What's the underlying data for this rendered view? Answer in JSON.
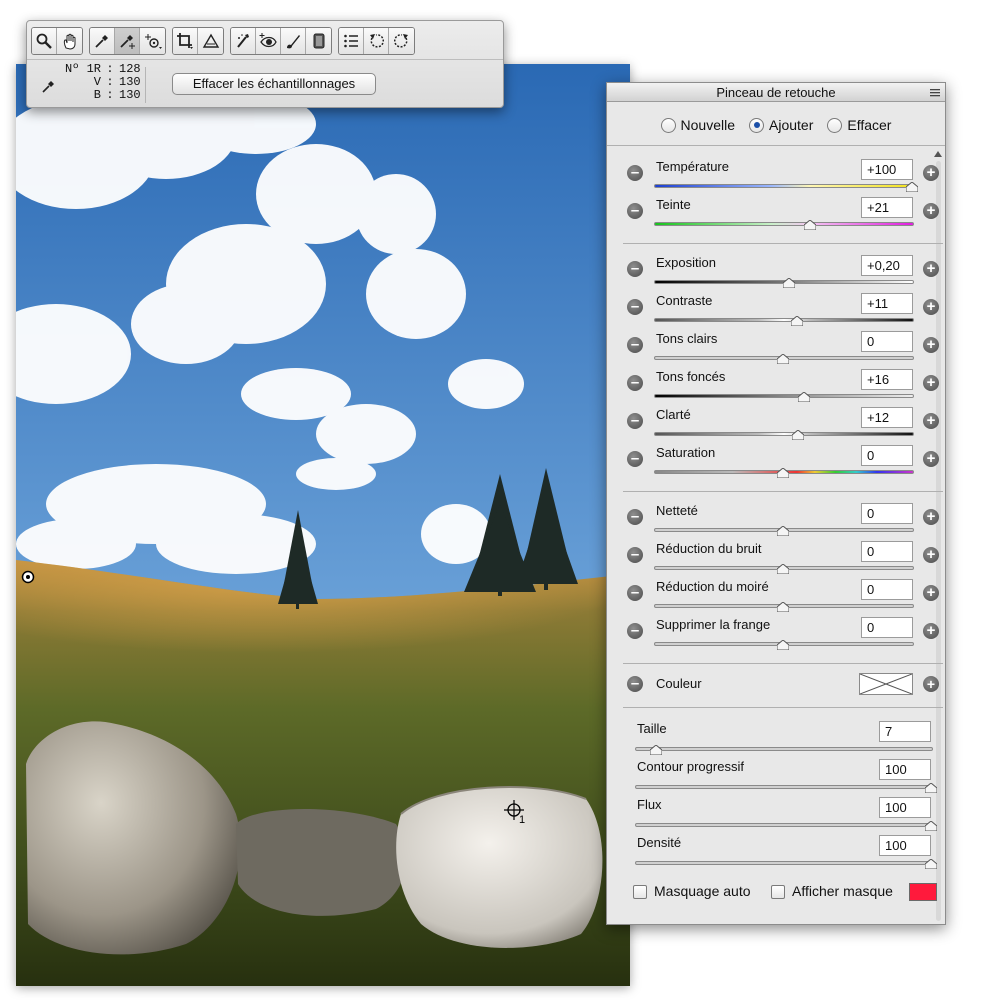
{
  "toolbar": {
    "tools": [
      [
        "zoom-tool-icon",
        "hand-tool-icon"
      ],
      [
        "white-balance-tool-icon",
        "color-sampler-tool-icon",
        "targeted-adjustment-tool-icon"
      ],
      [
        "crop-tool-icon",
        "straighten-tool-icon"
      ],
      [
        "spot-removal-tool-icon",
        "red-eye-tool-icon",
        "adjustment-brush-tool-icon",
        "graduated-filter-tool-icon"
      ],
      [
        "preferences-icon",
        "rotate-left-icon",
        "rotate-right-icon"
      ]
    ],
    "active_tool": "color-sampler-tool-icon",
    "readout": {
      "number_label": "Nº 1R",
      "r_value": "128",
      "v_label": "V",
      "v_value": "130",
      "b_label": "B",
      "b_value": "130"
    },
    "clear_samplers_label": "Effacer les échantillonnages"
  },
  "panel": {
    "title": "Pinceau de retouche",
    "modes": [
      {
        "label": "Nouvelle",
        "checked": false
      },
      {
        "label": "Ajouter",
        "checked": true
      },
      {
        "label": "Effacer",
        "checked": false
      }
    ],
    "sliders": [
      {
        "label": "Température",
        "value": "+100",
        "level": 1.0,
        "track": "temperature"
      },
      {
        "label": "Teinte",
        "value": "+21",
        "level": 0.605,
        "track": "tint"
      },
      {
        "label": "Exposition",
        "value": "+0,20",
        "level": 0.525,
        "track": "exposure"
      },
      {
        "label": "Contraste",
        "value": "+11",
        "level": 0.555,
        "track": "contrast"
      },
      {
        "label": "Tons clairs",
        "value": "0",
        "level": 0.5,
        "track": "plain"
      },
      {
        "label": "Tons foncés",
        "value": "+16",
        "level": 0.58,
        "track": "shadows"
      },
      {
        "label": "Clarté",
        "value": "+12",
        "level": 0.56,
        "track": "contrast"
      },
      {
        "label": "Saturation",
        "value": "0",
        "level": 0.5,
        "track": "saturation"
      },
      {
        "label": "Netteté",
        "value": "0",
        "level": 0.5,
        "track": "plain"
      },
      {
        "label": "Réduction du bruit",
        "value": "0",
        "level": 0.5,
        "track": "plain"
      },
      {
        "label": "Réduction du moiré",
        "value": "0",
        "level": 0.5,
        "track": "plain"
      },
      {
        "label": "Supprimer la frange",
        "value": "0",
        "level": 0.5,
        "track": "plain"
      }
    ],
    "color_label": "Couleur",
    "brush": [
      {
        "label": "Taille",
        "value": "7",
        "level": 0.07
      },
      {
        "label": "Contour progressif",
        "value": "100",
        "level": 1.0
      },
      {
        "label": "Flux",
        "value": "100",
        "level": 1.0
      },
      {
        "label": "Densité",
        "value": "100",
        "level": 1.0
      }
    ],
    "auto_mask_label": "Masquage auto",
    "show_mask_label": "Afficher masque",
    "mask_overlay_color": "#ff1a3c"
  },
  "photo": {
    "sampler_label": "1"
  }
}
